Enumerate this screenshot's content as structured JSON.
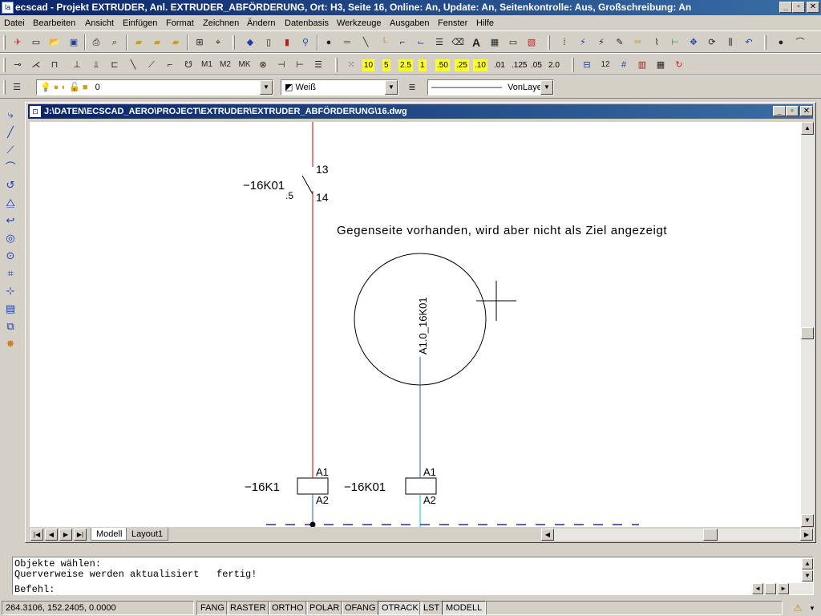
{
  "app": {
    "title": "ecscad - Projekt EXTRUDER, Anl. EXTRUDER_ABFÖRDERUNG, Ort: H3, Seite 16, Online: An, Update: An, Seitenkontrolle: Aus, Großschreibung: An",
    "icon_glyph": "la"
  },
  "menu": [
    "Datei",
    "Bearbeiten",
    "Ansicht",
    "Einfügen",
    "Format",
    "Zeichnen",
    "Ändern",
    "Datenbasis",
    "Werkzeuge",
    "Ausgaben",
    "Fenster",
    "Hilfe"
  ],
  "snap_values": [
    "10",
    "5",
    "2.5",
    "1",
    ".50",
    ".25",
    ".10",
    ".01",
    ".125",
    ".05",
    "2.0"
  ],
  "layer_bar": {
    "layer_value": "0",
    "color_value": "Weiß",
    "linetype_value": "VonLayer",
    "linetype_preview": "————————"
  },
  "document": {
    "path": "J:\\DATEN\\ECSCAD_AERO\\PROJECT\\EXTRUDER\\EXTRUDER_ABFÖRDERUNG\\16.dwg",
    "tabs": [
      "Modell",
      "Layout1"
    ]
  },
  "drawing": {
    "contact_label": "−16K01",
    "contact_ref": ".5",
    "contact_pin_top": "13",
    "contact_pin_bottom": "14",
    "note": "Gegenseite vorhanden, wird aber nicht als Ziel angezeigt",
    "circle_label": "A1.0_16K01",
    "coil1_label": "−16K1",
    "coil1_pin_top": "A1",
    "coil1_pin_bottom": "A2",
    "coil2_label": "−16K01",
    "coil2_pin_top": "A1",
    "coil2_pin_bottom": "A2",
    "colors": {
      "red_wire": "#c00000",
      "blue_wire": "#2060c0",
      "cyan_wire": "#00c8d8",
      "dashed_bus": "#2030b0"
    }
  },
  "command": {
    "lines": [
      "Objekte wählen:",
      "Querverweise werden aktualisiert   fertig!"
    ],
    "prompt": "Befehl:"
  },
  "status": {
    "coords": "264.3106, 152.2405, 0.0000",
    "modes": [
      "FANG",
      "RASTER",
      "ORTHO",
      "POLAR",
      "OFANG",
      "OTRACK",
      "LST",
      "MODELL"
    ],
    "active": [
      "OTRACK",
      "MODELL"
    ]
  }
}
